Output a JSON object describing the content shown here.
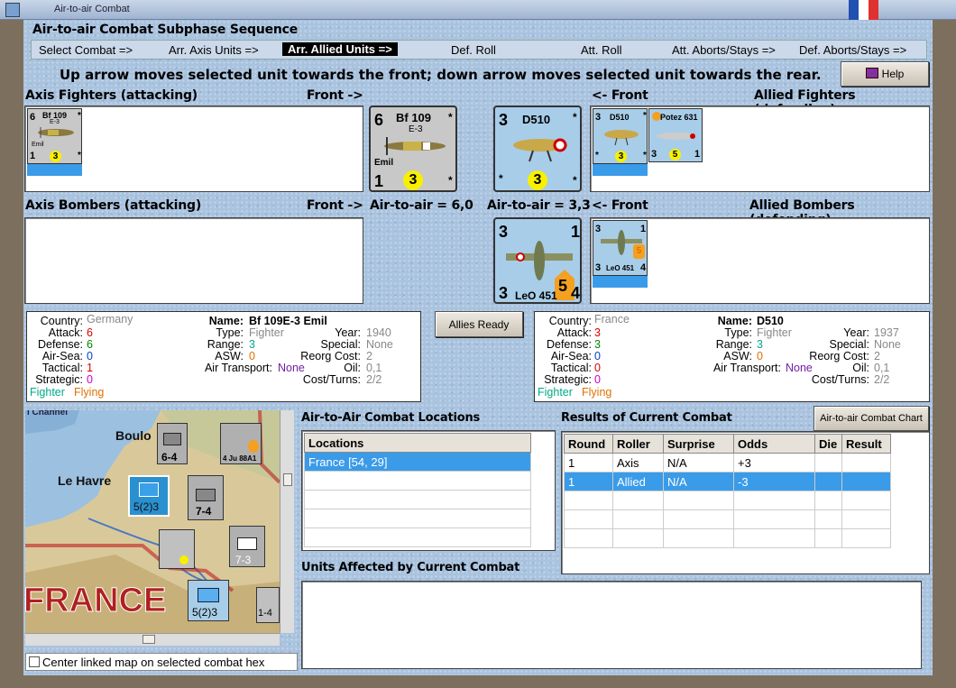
{
  "window": {
    "title": "Air-to-air Combat"
  },
  "sequence": {
    "title": "Air-to-air Combat Subphase Sequence",
    "items": [
      "Select Combat =>",
      "Arr. Axis Units =>",
      "Arr. Allied Units =>",
      "Def. Roll",
      "Att. Roll",
      "Att. Aborts/Stays =>",
      "Def. Aborts/Stays =>"
    ],
    "active": 2
  },
  "instruction": "Up arrow moves selected unit towards the front; down arrow moves selected unit towards the rear.",
  "help_label": "Help",
  "axis_fighters": {
    "label": "Axis Fighters (attacking)",
    "front": "Front ->",
    "unit": {
      "attack": "6",
      "name": "Bf 109",
      "sub": "E-3",
      "nick": "Emil",
      "defense": "1",
      "ring": "3",
      "star": "*"
    }
  },
  "allied_fighters": {
    "label": "Allied Fighters (defending)",
    "front": "<- Front",
    "units": [
      {
        "attack": "3",
        "name": "D510",
        "ring": "3",
        "star": "*"
      },
      {
        "attack": "3",
        "name": "Potez 631",
        "ring": "5",
        "range": "1"
      }
    ]
  },
  "axis_bombers": {
    "label": "Axis Bombers (attacking)",
    "front": "Front ->"
  },
  "allied_bombers": {
    "label": "Allied Bombers (defending)",
    "front": "<- Front",
    "unit": {
      "attack": "3",
      "tl": "3",
      "tr": "1",
      "ring": "5",
      "name": "LeO 451",
      "bl": "3",
      "br": "4"
    }
  },
  "air_to_air_axis": "Air-to-air = 6,0",
  "air_to_air_allied": "Air-to-air = 3,3",
  "allies_ready": "Allies Ready",
  "axis_info": {
    "country_k": "Country:",
    "country": "Germany",
    "attack_k": "Attack:",
    "attack": "6",
    "defense_k": "Defense:",
    "defense": "6",
    "airsea_k": "Air-Sea:",
    "airsea": "0",
    "tactical_k": "Tactical:",
    "tactical": "1",
    "strategic_k": "Strategic:",
    "strategic": "0",
    "type1": "Fighter",
    "type2": "Flying",
    "name_k": "Name:",
    "name": "Bf 109E-3 Emil",
    "type_k": "Type:",
    "type": "Fighter",
    "range_k": "Range:",
    "range": "3",
    "asw_k": "ASW:",
    "asw": "0",
    "at_k": "Air Transport:",
    "at": "None",
    "year_k": "Year:",
    "year": "1940",
    "special_k": "Special:",
    "special": "None",
    "reorg_k": "Reorg Cost:",
    "reorg": "2",
    "oil_k": "Oil:",
    "oil": "0,1",
    "cost_k": "Cost/Turns:",
    "cost": "2/2"
  },
  "allied_info": {
    "country_k": "Country:",
    "country": "France",
    "attack_k": "Attack:",
    "attack": "3",
    "defense_k": "Defense:",
    "defense": "3",
    "airsea_k": "Air-Sea:",
    "airsea": "0",
    "tactical_k": "Tactical:",
    "tactical": "0",
    "strategic_k": "Strategic:",
    "strategic": "0",
    "type1": "Fighter",
    "type2": "Flying",
    "name_k": "Name:",
    "name": "D510",
    "type_k": "Type:",
    "type": "Fighter",
    "range_k": "Range:",
    "range": "3",
    "asw_k": "ASW:",
    "asw": "0",
    "at_k": "Air Transport:",
    "at": "None",
    "year_k": "Year:",
    "year": "1937",
    "special_k": "Special:",
    "special": "None",
    "reorg_k": "Reorg Cost:",
    "reorg": "2",
    "oil_k": "Oil:",
    "oil": "0,1",
    "cost_k": "Cost/Turns:",
    "cost": "2/2"
  },
  "locations": {
    "title": "Air-to-Air Combat Locations",
    "header": "Locations",
    "rows": [
      "France [54, 29]"
    ]
  },
  "results": {
    "title": "Results of Current Combat",
    "chart_button": "Air-to-air Combat Chart",
    "headers": [
      "Round",
      "Roller",
      "Surprise",
      "Odds",
      "Die",
      "Result"
    ],
    "rows": [
      [
        "1",
        "Axis",
        "N/A",
        "+3",
        "",
        ""
      ],
      [
        "1",
        "Allied",
        "N/A",
        "-3",
        "",
        ""
      ]
    ]
  },
  "affected": {
    "title": "Units Affected by Current Combat"
  },
  "map": {
    "labels": {
      "channel": "l Channel",
      "boulogne": "Boulo",
      "le_havre": "Le Havre",
      "france": "FRANCE"
    },
    "units": [
      {
        "v": "6-4"
      },
      {
        "v": "7-4"
      },
      {
        "v": "7-3"
      },
      {
        "v": "5(2)3"
      },
      {
        "v": "5(2)3"
      },
      {
        "v": "1-4"
      }
    ],
    "ju": "4 Ju 88A1"
  },
  "center_map": "Center linked map on selected combat hex"
}
